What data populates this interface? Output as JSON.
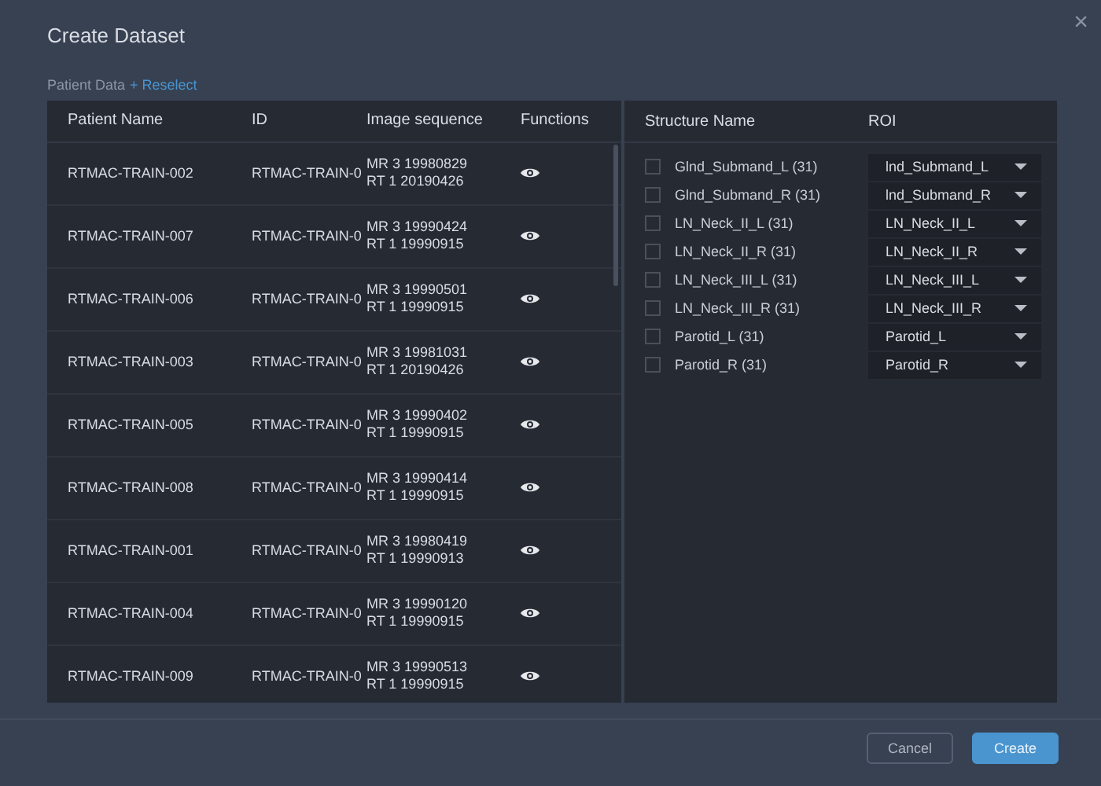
{
  "dialog": {
    "title": "Create Dataset",
    "close": "×"
  },
  "section": {
    "label": "Patient Data",
    "link": "+ Reselect"
  },
  "patients": {
    "columns": [
      "Patient Name",
      "ID",
      "Image sequence",
      "Functions"
    ],
    "rows": [
      {
        "name": "RTMAC-TRAIN-002",
        "id": "RTMAC-TRAIN-0",
        "seq": [
          "MR 3 19980829",
          "RT 1 20190426"
        ]
      },
      {
        "name": "RTMAC-TRAIN-007",
        "id": "RTMAC-TRAIN-0",
        "seq": [
          "MR 3 19990424",
          "RT 1 19990915"
        ]
      },
      {
        "name": "RTMAC-TRAIN-006",
        "id": "RTMAC-TRAIN-0",
        "seq": [
          "MR 3 19990501",
          "RT 1 19990915"
        ]
      },
      {
        "name": "RTMAC-TRAIN-003",
        "id": "RTMAC-TRAIN-0",
        "seq": [
          "MR 3 19981031",
          "RT 1 20190426"
        ]
      },
      {
        "name": "RTMAC-TRAIN-005",
        "id": "RTMAC-TRAIN-0",
        "seq": [
          "MR 3 19990402",
          "RT 1 19990915"
        ]
      },
      {
        "name": "RTMAC-TRAIN-008",
        "id": "RTMAC-TRAIN-0",
        "seq": [
          "MR 3 19990414",
          "RT 1 19990915"
        ]
      },
      {
        "name": "RTMAC-TRAIN-001",
        "id": "RTMAC-TRAIN-0",
        "seq": [
          "MR 3 19980419",
          "RT 1 19990913"
        ]
      },
      {
        "name": "RTMAC-TRAIN-004",
        "id": "RTMAC-TRAIN-0",
        "seq": [
          "MR 3 19990120",
          "RT 1 19990915"
        ]
      },
      {
        "name": "RTMAC-TRAIN-009",
        "id": "RTMAC-TRAIN-0",
        "seq": [
          "MR 3 19990513",
          "RT 1 19990915"
        ]
      }
    ]
  },
  "structures": {
    "columns": [
      "Structure Name",
      "ROI"
    ],
    "rows": [
      {
        "name": "Glnd_Submand_L (31)",
        "checked": false,
        "roi": "lnd_Submand_L"
      },
      {
        "name": "Glnd_Submand_R (31)",
        "checked": false,
        "roi": "lnd_Submand_R"
      },
      {
        "name": "LN_Neck_II_L (31)",
        "checked": false,
        "roi": "LN_Neck_II_L"
      },
      {
        "name": "LN_Neck_II_R (31)",
        "checked": false,
        "roi": "LN_Neck_II_R"
      },
      {
        "name": "LN_Neck_III_L (31)",
        "checked": false,
        "roi": "LN_Neck_III_L"
      },
      {
        "name": "LN_Neck_III_R (31)",
        "checked": false,
        "roi": "LN_Neck_III_R"
      },
      {
        "name": "Parotid_L (31)",
        "checked": false,
        "roi": "Parotid_L"
      },
      {
        "name": "Parotid_R (31)",
        "checked": false,
        "roi": "Parotid_R"
      }
    ]
  },
  "buttons": [
    "Cancel",
    "Create"
  ]
}
